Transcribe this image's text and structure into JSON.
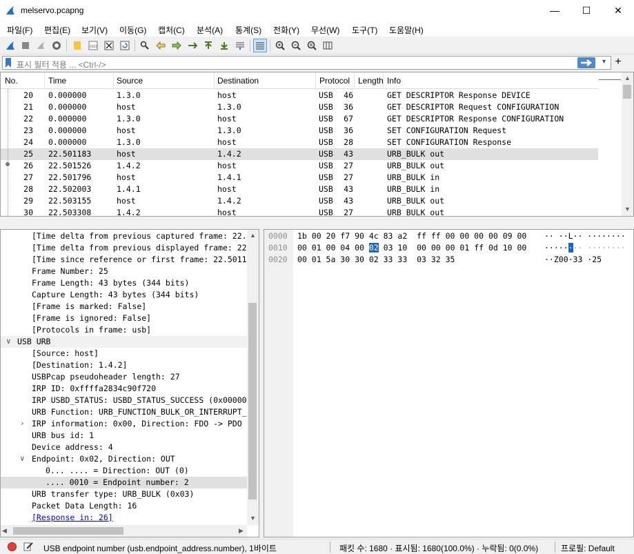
{
  "window": {
    "title": "melservo.pcapng",
    "min": "—",
    "max": "☐",
    "close": "✕"
  },
  "menu": [
    "파일(F)",
    "편집(E)",
    "보기(V)",
    "이동(G)",
    "캡처(C)",
    "분석(A)",
    "통계(S)",
    "전화(Y)",
    "무선(W)",
    "도구(T)",
    "도움말(H)"
  ],
  "filter": {
    "placeholder": "표시 필터 적용 ... <Ctrl-/>",
    "add": "+"
  },
  "packet_list": {
    "columns": [
      "No.",
      "Time",
      "Source",
      "Destination",
      "Protocol",
      "Length",
      "Info"
    ],
    "rows": [
      {
        "no": "20",
        "time": "0.000000",
        "src": "1.3.0",
        "dst": "host",
        "proto": "USB",
        "len": "46",
        "info": "GET DESCRIPTOR Response DEVICE"
      },
      {
        "no": "21",
        "time": "0.000000",
        "src": "host",
        "dst": "1.3.0",
        "proto": "USB",
        "len": "36",
        "info": "GET DESCRIPTOR Request CONFIGURATION"
      },
      {
        "no": "22",
        "time": "0.000000",
        "src": "1.3.0",
        "dst": "host",
        "proto": "USB",
        "len": "67",
        "info": "GET DESCRIPTOR Response CONFIGURATION"
      },
      {
        "no": "23",
        "time": "0.000000",
        "src": "host",
        "dst": "1.3.0",
        "proto": "USB",
        "len": "36",
        "info": "SET CONFIGURATION Request"
      },
      {
        "no": "24",
        "time": "0.000000",
        "src": "1.3.0",
        "dst": "host",
        "proto": "USB",
        "len": "28",
        "info": "SET CONFIGURATION Response"
      },
      {
        "no": "25",
        "time": "22.501183",
        "src": "host",
        "dst": "1.4.2",
        "proto": "USB",
        "len": "43",
        "info": "URB_BULK out"
      },
      {
        "no": "26",
        "time": "22.501526",
        "src": "1.4.2",
        "dst": "host",
        "proto": "USB",
        "len": "27",
        "info": "URB_BULK out"
      },
      {
        "no": "27",
        "time": "22.501796",
        "src": "host",
        "dst": "1.4.1",
        "proto": "USB",
        "len": "27",
        "info": "URB_BULK in"
      },
      {
        "no": "28",
        "time": "22.502003",
        "src": "1.4.1",
        "dst": "host",
        "proto": "USB",
        "len": "43",
        "info": "URB_BULK in"
      },
      {
        "no": "29",
        "time": "22.503155",
        "src": "host",
        "dst": "1.4.2",
        "proto": "USB",
        "len": "43",
        "info": "URB_BULK out"
      },
      {
        "no": "30",
        "time": "22.503308",
        "src": "1.4.2",
        "dst": "host",
        "proto": "USB",
        "len": "27",
        "info": "URB_BULK out"
      }
    ]
  },
  "details": [
    "[Time delta from previous captured frame: 22.",
    "[Time delta from previous displayed frame: 22",
    "[Time since reference or first frame: 22.5011",
    "Frame Number: 25",
    "Frame Length: 43 bytes (344 bits)",
    "Capture Length: 43 bytes (344 bits)",
    "[Frame is marked: False]",
    "[Frame is ignored: False]",
    "[Protocols in frame: usb]",
    "USB URB",
    "[Source: host]",
    "[Destination: 1.4.2]",
    "USBPcap pseudoheader length: 27",
    "IRP ID: 0xffffa2834c90f720",
    "IRP USBD_STATUS: USBD_STATUS_SUCCESS (0x00000",
    "URB Function: URB_FUNCTION_BULK_OR_INTERRUPT_",
    "IRP information: 0x00, Direction: FDO -> PDO",
    "URB bus id: 1",
    "Device address: 4",
    "Endpoint: 0x02, Direction: OUT",
    "0... .... = Direction: OUT (0)",
    ".... 0010 = Endpoint number: 2",
    "URB transfer type: URB_BULK (0x03)",
    "Packet Data Length: 16",
    "[Response in: 26]"
  ],
  "hex": [
    {
      "off": "0000",
      "pre": "1b 00 20 f7 90 4c 83 a2  ff ff 00 00 00 00 09 00",
      "hl": "",
      "post": "",
      "ascii": "·· ··L·· ········"
    },
    {
      "off": "0010",
      "pre": "00 01 00 04 00 ",
      "hl": "02",
      "post": " 03 10  00 00 00 01 ff 0d 10 00",
      "ascii_pre": "·····",
      "ascii_hl": "·",
      "ascii_post": "·· ········"
    },
    {
      "off": "0020",
      "pre": "00 01 5a 30 30 02 33 33  03 32 35",
      "hl": "",
      "post": "",
      "ascii": "··Z00·33 ·25"
    }
  ],
  "status": {
    "field": "USB endpoint number (usb.endpoint_address.number), 1바이트",
    "packets": "패킷 수: 1680 · 표시됨: 1680(100.0%) · 누락됨: 0(0.0%)",
    "profile": "프로필: Default"
  }
}
